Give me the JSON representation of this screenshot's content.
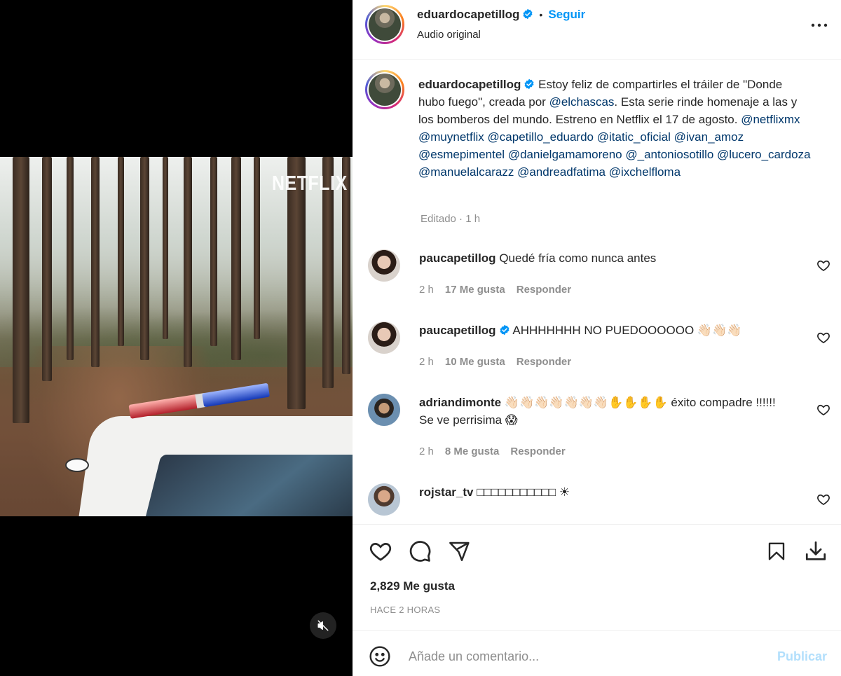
{
  "media": {
    "watermark": "NETFLIX",
    "mute_icon": "volume-muted-icon"
  },
  "header": {
    "username": "eduardocapetillog",
    "separator": "•",
    "follow_label": "Seguir",
    "subtitle": "Audio original",
    "more_icon": "more-horizontal-icon"
  },
  "caption": {
    "username": "eduardocapetillog",
    "segments": [
      {
        "t": "Estoy feliz de compartirles el tráiler de \"Donde hubo fuego\", creada por ",
        "m": false
      },
      {
        "t": "@elchascas",
        "m": true
      },
      {
        "t": ". Esta serie rinde homenaje a las y los bomberos del mundo. Estreno en Netflix el 17 de agosto. ",
        "m": false
      },
      {
        "t": "@netflixmx",
        "m": true
      },
      {
        "t": " ",
        "m": false
      },
      {
        "t": "@muynetflix",
        "m": true
      },
      {
        "t": " ",
        "m": false
      },
      {
        "t": "@capetillo_eduardo",
        "m": true
      },
      {
        "t": " ",
        "m": false
      },
      {
        "t": "@itatic_oficial",
        "m": true
      },
      {
        "t": " ",
        "m": false
      },
      {
        "t": "@ivan_amoz",
        "m": true
      },
      {
        "t": " ",
        "m": false
      },
      {
        "t": "@esmepimentel",
        "m": true
      },
      {
        "t": " ",
        "m": false
      },
      {
        "t": "@danielgamamoreno",
        "m": true
      },
      {
        "t": " ",
        "m": false
      },
      {
        "t": "@_antoniosotillo",
        "m": true
      },
      {
        "t": " ",
        "m": false
      },
      {
        "t": "@lucero_cardoza",
        "m": true
      },
      {
        "t": " ",
        "m": false
      },
      {
        "t": "@manuelalcarazz",
        "m": true
      },
      {
        "t": " ",
        "m": false
      },
      {
        "t": "@andreadfatima",
        "m": true
      },
      {
        "t": " ",
        "m": false
      },
      {
        "t": "@ixchelfloma",
        "m": true
      }
    ],
    "edited": "Editado",
    "dot": "·",
    "age": "1 h"
  },
  "comments": [
    {
      "username": "paucapetillog",
      "verified": false,
      "text": "Quedé fría como nunca antes",
      "text2": "",
      "age": "2 h",
      "likes": "17 Me gusta",
      "reply": "Responder"
    },
    {
      "username": "paucapetillog",
      "verified": true,
      "text": "AHHHHHHH NO PUEDOOOOOO 👋🏻👋🏻👋🏻",
      "text2": "",
      "age": "2 h",
      "likes": "10 Me gusta",
      "reply": "Responder"
    },
    {
      "username": "adriandimonte",
      "verified": false,
      "text": "👋🏻👋🏻👋🏻👋🏻👋🏻👋🏻👋🏻✋✋✋✋ éxito compadre !!!!!!",
      "text2": "Se ve perrisima 😱",
      "age": "2 h",
      "likes": "8 Me gusta",
      "reply": "Responder"
    },
    {
      "username": "rojstar_tv",
      "verified": false,
      "text": "□□□□□□□□□□□ ☀",
      "text2": "",
      "age": "",
      "likes": "",
      "reply": ""
    }
  ],
  "actions": {
    "like_icon": "heart-icon",
    "comment_icon": "comment-bubble-icon",
    "share_icon": "paper-plane-icon",
    "save_icon": "bookmark-icon",
    "download_icon": "download-icon",
    "likes_count": "2,829 Me gusta",
    "timestamp": "HACE 2 HORAS"
  },
  "add_comment": {
    "placeholder": "Añade un comentario...",
    "publish_label": "Publicar",
    "emoji_icon": "smiley-icon"
  },
  "colors": {
    "accent": "#0095f6",
    "mention": "#00376b",
    "muted": "#8e8e8e",
    "publish_disabled": "#b2dffc",
    "verified": "#0095f6"
  }
}
